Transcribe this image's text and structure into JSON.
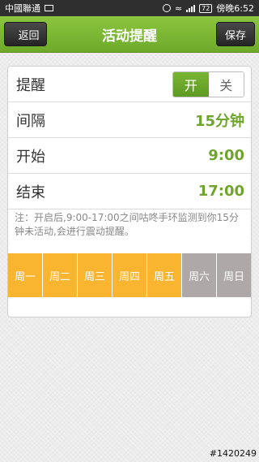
{
  "status_bar": {
    "carrier": "中國聯通",
    "time": "傍晚6:52",
    "battery": "72"
  },
  "header": {
    "back_label": "返回",
    "title": "活动提醒",
    "save_label": "保存"
  },
  "reminder": {
    "label": "提醒",
    "on_label": "开",
    "off_label": "关",
    "state": "on"
  },
  "interval": {
    "label": "间隔",
    "value": "15分钟"
  },
  "start": {
    "label": "开始",
    "value": "9:00"
  },
  "end": {
    "label": "结束",
    "value": "17:00"
  },
  "note": "注：开启后,9:00-17:00之间咕咚手环监测到你15分钟未活动,会进行震动提醒。",
  "days": [
    {
      "label": "周一",
      "active": true
    },
    {
      "label": "周二",
      "active": true
    },
    {
      "label": "周三",
      "active": true
    },
    {
      "label": "周四",
      "active": true
    },
    {
      "label": "周五",
      "active": true
    },
    {
      "label": "周六",
      "active": false
    },
    {
      "label": "周日",
      "active": false
    }
  ],
  "colors": {
    "accent": "#7bb534",
    "day_active": "#f9b52f",
    "day_inactive": "#aea8a8"
  },
  "watermark": "#1420249"
}
